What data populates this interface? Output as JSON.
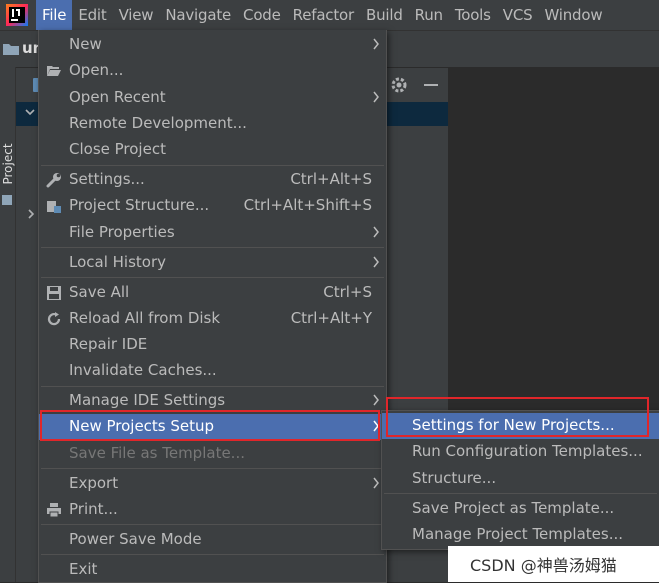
{
  "menubar": {
    "items": [
      {
        "label": "File",
        "active": true
      },
      {
        "label": "Edit"
      },
      {
        "label": "View"
      },
      {
        "label": "Navigate"
      },
      {
        "label": "Code"
      },
      {
        "label": "Refactor"
      },
      {
        "label": "Build"
      },
      {
        "label": "Run"
      },
      {
        "label": "Tools"
      },
      {
        "label": "VCS"
      },
      {
        "label": "Window"
      }
    ]
  },
  "navbar": {
    "crumb": "un"
  },
  "toolstrip": {
    "label": "Project"
  },
  "file_menu": {
    "new": "New",
    "open": "Open...",
    "open_recent": "Open Recent",
    "remote_development": "Remote Development...",
    "close_project": "Close Project",
    "settings": "Settings...",
    "settings_shortcut": "Ctrl+Alt+S",
    "project_structure": "Project Structure...",
    "project_structure_shortcut": "Ctrl+Alt+Shift+S",
    "file_properties": "File Properties",
    "local_history": "Local History",
    "save_all": "Save All",
    "save_all_shortcut": "Ctrl+S",
    "reload_all": "Reload All from Disk",
    "reload_all_shortcut": "Ctrl+Alt+Y",
    "repair_ide": "Repair IDE",
    "invalidate_caches": "Invalidate Caches...",
    "manage_ide_settings": "Manage IDE Settings",
    "new_projects_setup": "New Projects Setup",
    "save_file_as_template": "Save File as Template...",
    "export": "Export",
    "print": "Print...",
    "power_save_mode": "Power Save Mode",
    "exit": "Exit"
  },
  "submenu": {
    "settings_for_new_projects": "Settings for New Projects...",
    "run_configuration_templates": "Run Configuration Templates...",
    "structure": "Structure...",
    "save_project_as_template": "Save Project as Template...",
    "manage_project_templates": "Manage Project Templates..."
  },
  "watermark": "CSDN @神兽汤姆猫",
  "colors": {
    "highlight": "#4b6eaf",
    "annotation_red": "#e0262a",
    "menu_bg": "#3c3f41"
  }
}
